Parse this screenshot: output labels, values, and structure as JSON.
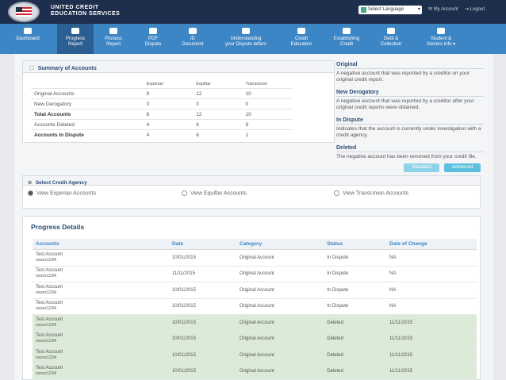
{
  "header": {
    "brand_line1": "UNITED CREDIT",
    "brand_line2": "EDUCATION SERVICES",
    "language_select": "Select Language",
    "account_link": "My Account",
    "logout_link": "Logout"
  },
  "nav": [
    {
      "icon": "dashboard-icon",
      "l1": "Dashboard",
      "l2": "",
      "active": false
    },
    {
      "icon": "chart-icon",
      "l1": "Progress",
      "l2": "Report",
      "active": true
    },
    {
      "icon": "process-icon",
      "l1": "Process",
      "l2": "Report",
      "active": false
    },
    {
      "icon": "pdf-icon",
      "l1": "PDF",
      "l2": "Dispute",
      "active": false
    },
    {
      "icon": "id-icon",
      "l1": "ID",
      "l2": "Document",
      "active": false
    },
    {
      "icon": "book-icon",
      "l1": "Understanding",
      "l2": "your Dispute letters",
      "active": false
    },
    {
      "icon": "credit-card-icon",
      "l1": "Credit",
      "l2": "Education",
      "active": false
    },
    {
      "icon": "building-icon",
      "l1": "Establishing",
      "l2": "Credit",
      "active": false
    },
    {
      "icon": "dollar-icon",
      "l1": "Debt &",
      "l2": "Collection",
      "active": false
    },
    {
      "icon": "users-icon",
      "l1": "Student &",
      "l2": "Seniors info ▾",
      "active": false
    }
  ],
  "summary": {
    "title": "Summary of Accounts",
    "columns": [
      "",
      "Experian",
      "Equifax",
      "Transunion"
    ],
    "rows": [
      {
        "label": "Original Accounts",
        "values": [
          "8",
          "12",
          "10"
        ],
        "bold": false
      },
      {
        "label": "New Derogatory",
        "values": [
          "0",
          "0",
          "0"
        ],
        "bold": false
      },
      {
        "label": "Total Accounts",
        "values": [
          "8",
          "12",
          "10"
        ],
        "bold": true
      },
      {
        "label": "Accounts Deleted",
        "values": [
          "4",
          "6",
          "9"
        ],
        "bold": false
      },
      {
        "label": "Accounts In Dispute",
        "values": [
          "4",
          "6",
          "1"
        ],
        "bold": true
      }
    ]
  },
  "definitions": [
    {
      "term": "Original",
      "text": "A negative account that was reported by a creditor on your original credit report."
    },
    {
      "term": "New Derogatory",
      "text": "A negative account that was reported by a creditor after your original credit reports were obtained."
    },
    {
      "term": "In Dispute",
      "text": "Indicates that the account is currently under investigation with a credit agency."
    },
    {
      "term": "Deleted",
      "text": "The negative account has been removed from your credit file."
    }
  ],
  "buttons": {
    "standard": "Standard",
    "advanced": "Advanced"
  },
  "agency": {
    "title": "Select Credit Agency",
    "options": [
      "View Experian Accounts",
      "View Equifax Accounts",
      "View TransUnion Accounts"
    ],
    "selected": 0
  },
  "progress": {
    "title": "Progress Details",
    "columns": [
      "Accounts",
      "Date",
      "Category",
      "Status",
      "Date of Change"
    ],
    "rows": [
      {
        "name": "Test Account",
        "num": "xxxxx1234",
        "date": "10/01/2015",
        "category": "Original Account",
        "status": "In Dispute",
        "change": "NA"
      },
      {
        "name": "Test Account",
        "num": "xxxxx1234",
        "date": "11/11/2015",
        "category": "Original Account",
        "status": "In Dispute",
        "change": "NA"
      },
      {
        "name": "Test Account",
        "num": "xxxxx1234",
        "date": "10/01/2015",
        "category": "Original Account",
        "status": "In Dispute",
        "change": "NA"
      },
      {
        "name": "Test Account",
        "num": "xxxxx1234",
        "date": "10/01/2015",
        "category": "Original Account",
        "status": "In Dispute",
        "change": "NA"
      },
      {
        "name": "Test Account",
        "num": "xxxxx1234",
        "date": "10/01/2015",
        "category": "Original Account",
        "status": "Deleted",
        "change": "11/11/2015"
      },
      {
        "name": "Test Account",
        "num": "xxxxx1234",
        "date": "10/01/2015",
        "category": "Original Account",
        "status": "Deleted",
        "change": "11/11/2015"
      },
      {
        "name": "Test Account",
        "num": "xxxxx1234",
        "date": "10/01/2015",
        "category": "Original Account",
        "status": "Deleted",
        "change": "11/11/2015"
      },
      {
        "name": "Test Account",
        "num": "xxxxx1234",
        "date": "10/01/2015",
        "category": "Original Account",
        "status": "Deleted",
        "change": "11/11/2015"
      }
    ]
  },
  "colors": {
    "header": "#1e2f4d",
    "nav": "#3d86c6",
    "nav_active": "#2b5f94",
    "deleted_row": "#dcebd8",
    "button": "#5bc0de"
  }
}
